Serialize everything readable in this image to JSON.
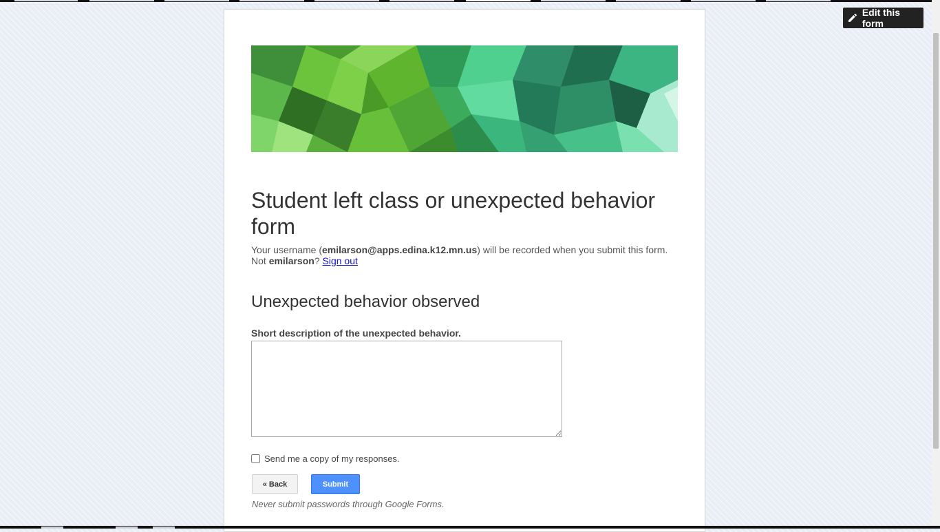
{
  "toolbar": {
    "edit_label": "Edit this form",
    "edit_icon": "pencil-icon"
  },
  "form": {
    "title": "Student left class or unexpected behavior form",
    "username_prefix": "Your username (",
    "username_email": "emilarson@apps.edina.k12.mn.us",
    "username_suffix": ") will be recorded when you submit this form. Not ",
    "username_short": "emilarson",
    "username_question": "? ",
    "sign_out_label": "Sign out",
    "section_title": "Unexpected behavior observed",
    "question_label": "Short description of the unexpected behavior.",
    "answer_value": "",
    "copy_label": "Send me a copy of my responses.",
    "copy_checked": false,
    "back_label": "« Back",
    "submit_label": "Submit",
    "disclaimer": "Never submit passwords through Google Forms."
  },
  "colors": {
    "submit_bg": "#4d90fe",
    "edit_bg": "#222222",
    "link": "#1111cc"
  }
}
